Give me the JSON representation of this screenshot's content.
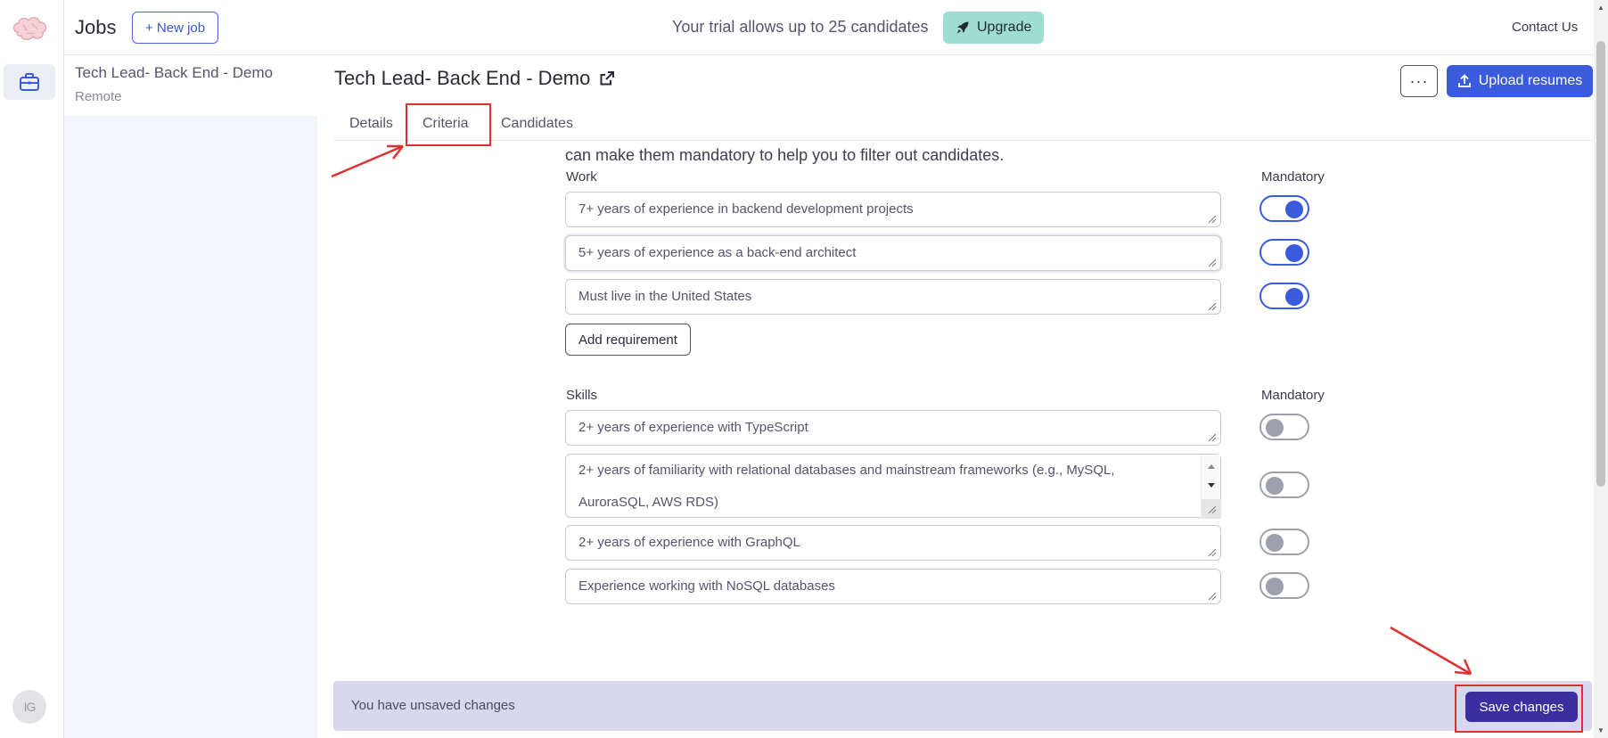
{
  "topbar": {
    "jobs_title": "Jobs",
    "new_job_label": "+ New job",
    "trial_text": "Your trial allows up to 25 candidates",
    "upgrade_label": "Upgrade",
    "contact_label": "Contact Us"
  },
  "rail": {
    "avatar_initials": "IG"
  },
  "joblist": {
    "items": [
      {
        "name": "Tech Lead- Back End - Demo",
        "location": "Remote"
      }
    ]
  },
  "job": {
    "title": "Tech Lead- Back End - Demo",
    "more_label": "···",
    "upload_label": "Upload resumes"
  },
  "tabs": [
    {
      "label": "Details"
    },
    {
      "label": "Criteria"
    },
    {
      "label": "Candidates"
    }
  ],
  "criteria": {
    "intro": "can make them mandatory to help you to filter out candidates.",
    "mandatory_label": "Mandatory",
    "work": {
      "label": "Work",
      "items": [
        {
          "text": "7+ years of experience in backend development projects",
          "mandatory": true
        },
        {
          "text": "5+ years of experience as a back-end architect",
          "mandatory": true
        },
        {
          "text": "Must live in the United States",
          "mandatory": true
        }
      ],
      "add_label": "Add requirement"
    },
    "skills": {
      "label": "Skills",
      "items": [
        {
          "text": "2+ years of experience with TypeScript",
          "mandatory": false
        },
        {
          "text_line1": "2+ years of familiarity with relational databases and mainstream frameworks (e.g., MySQL,",
          "text_line2": "AuroraSQL, AWS RDS)",
          "mandatory": false
        },
        {
          "text": "2+ years of experience with GraphQL",
          "mandatory": false
        },
        {
          "text": "Experience working with NoSQL databases",
          "mandatory": false
        }
      ]
    }
  },
  "savebar": {
    "message": "You have unsaved changes",
    "save_label": "Save changes"
  },
  "colors": {
    "primary": "#3a5bdc",
    "save_button": "#3a2f9e",
    "savebar_bg": "#d9d7f0",
    "upgrade_bg": "#9fdcd3",
    "annotation_red": "#e03030"
  }
}
